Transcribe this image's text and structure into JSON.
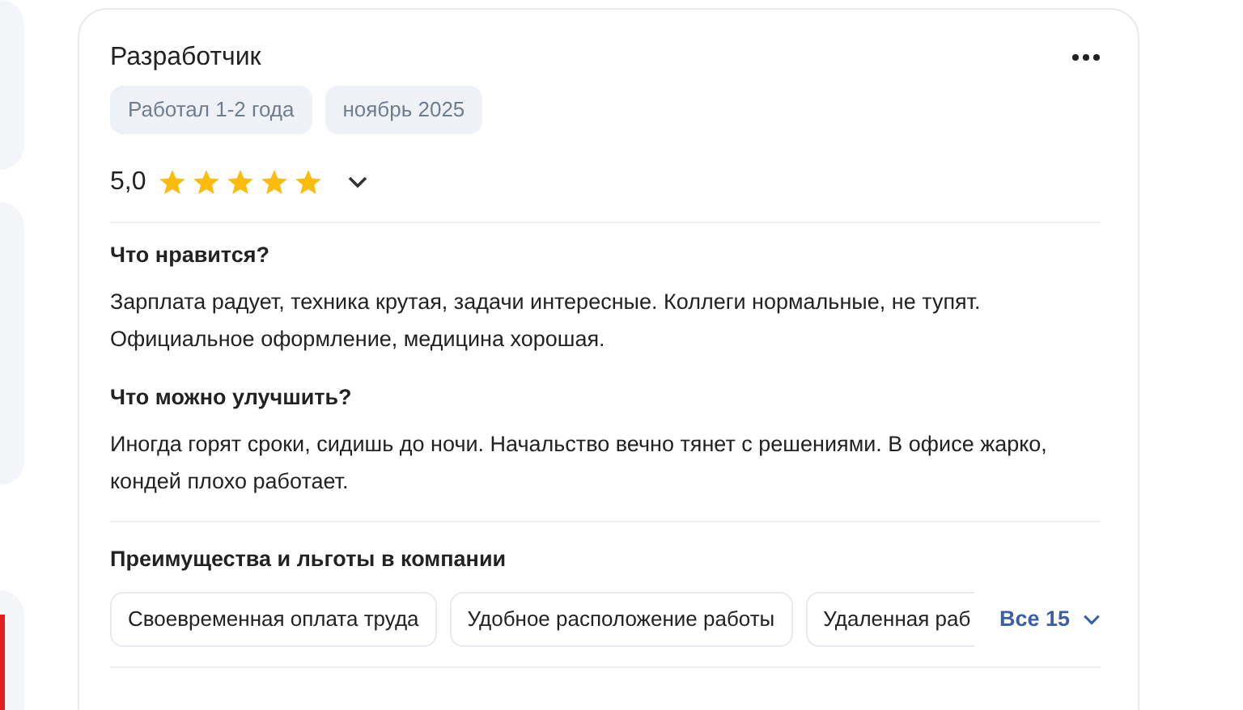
{
  "review": {
    "position": "Разработчик",
    "tags": [
      "Работал 1-2 года",
      "ноябрь 2025"
    ],
    "rating": "5,0",
    "stars": 5,
    "sections": [
      {
        "heading": "Что нравится?",
        "text": "Зарплата радует, техника крутая, задачи интересные. Коллеги нормальные, не тупят. Официальное оформление, медицина хорошая."
      },
      {
        "heading": "Что можно улучшить?",
        "text": "Иногда горят сроки, сидишь до ночи. Начальство вечно тянет с решениями. В офисе жарко, кондей плохо работает."
      }
    ],
    "benefits": {
      "heading": "Преимущества и льготы в компании",
      "items": [
        "Своевременная оплата труда",
        "Удобное расположение работы",
        "Удаленная раб"
      ],
      "more": "Все 15"
    }
  }
}
